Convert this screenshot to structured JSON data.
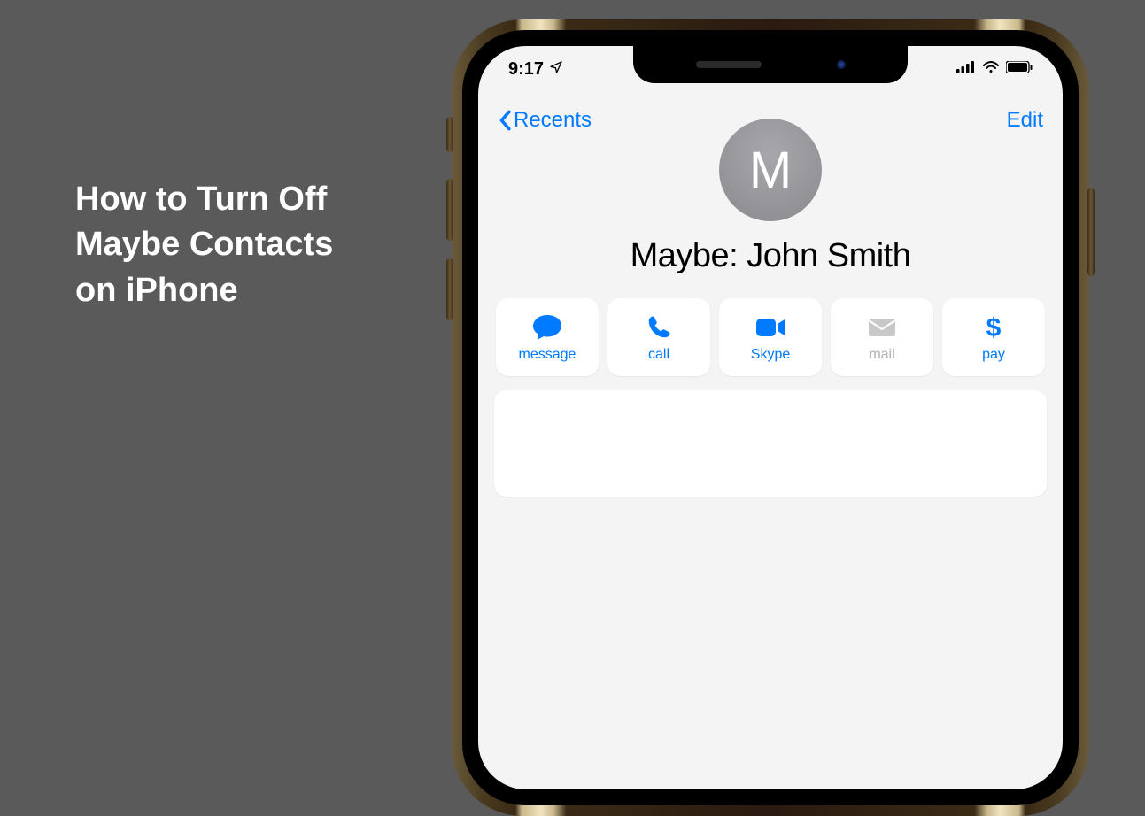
{
  "headline": "How to Turn Off\nMaybe Contacts\non iPhone",
  "status": {
    "time": "9:17",
    "location_icon": "location-arrow-icon"
  },
  "nav": {
    "back_label": "Recents",
    "edit_label": "Edit"
  },
  "contact": {
    "initial": "M",
    "display_name": "Maybe: John Smith"
  },
  "actions": [
    {
      "key": "message",
      "label": "message",
      "icon": "message-icon",
      "enabled": true
    },
    {
      "key": "call",
      "label": "call",
      "icon": "phone-icon",
      "enabled": true
    },
    {
      "key": "skype",
      "label": "Skype",
      "icon": "video-icon",
      "enabled": true
    },
    {
      "key": "mail",
      "label": "mail",
      "icon": "mail-icon",
      "enabled": false
    },
    {
      "key": "pay",
      "label": "pay",
      "icon": "dollar-icon",
      "enabled": true
    }
  ]
}
